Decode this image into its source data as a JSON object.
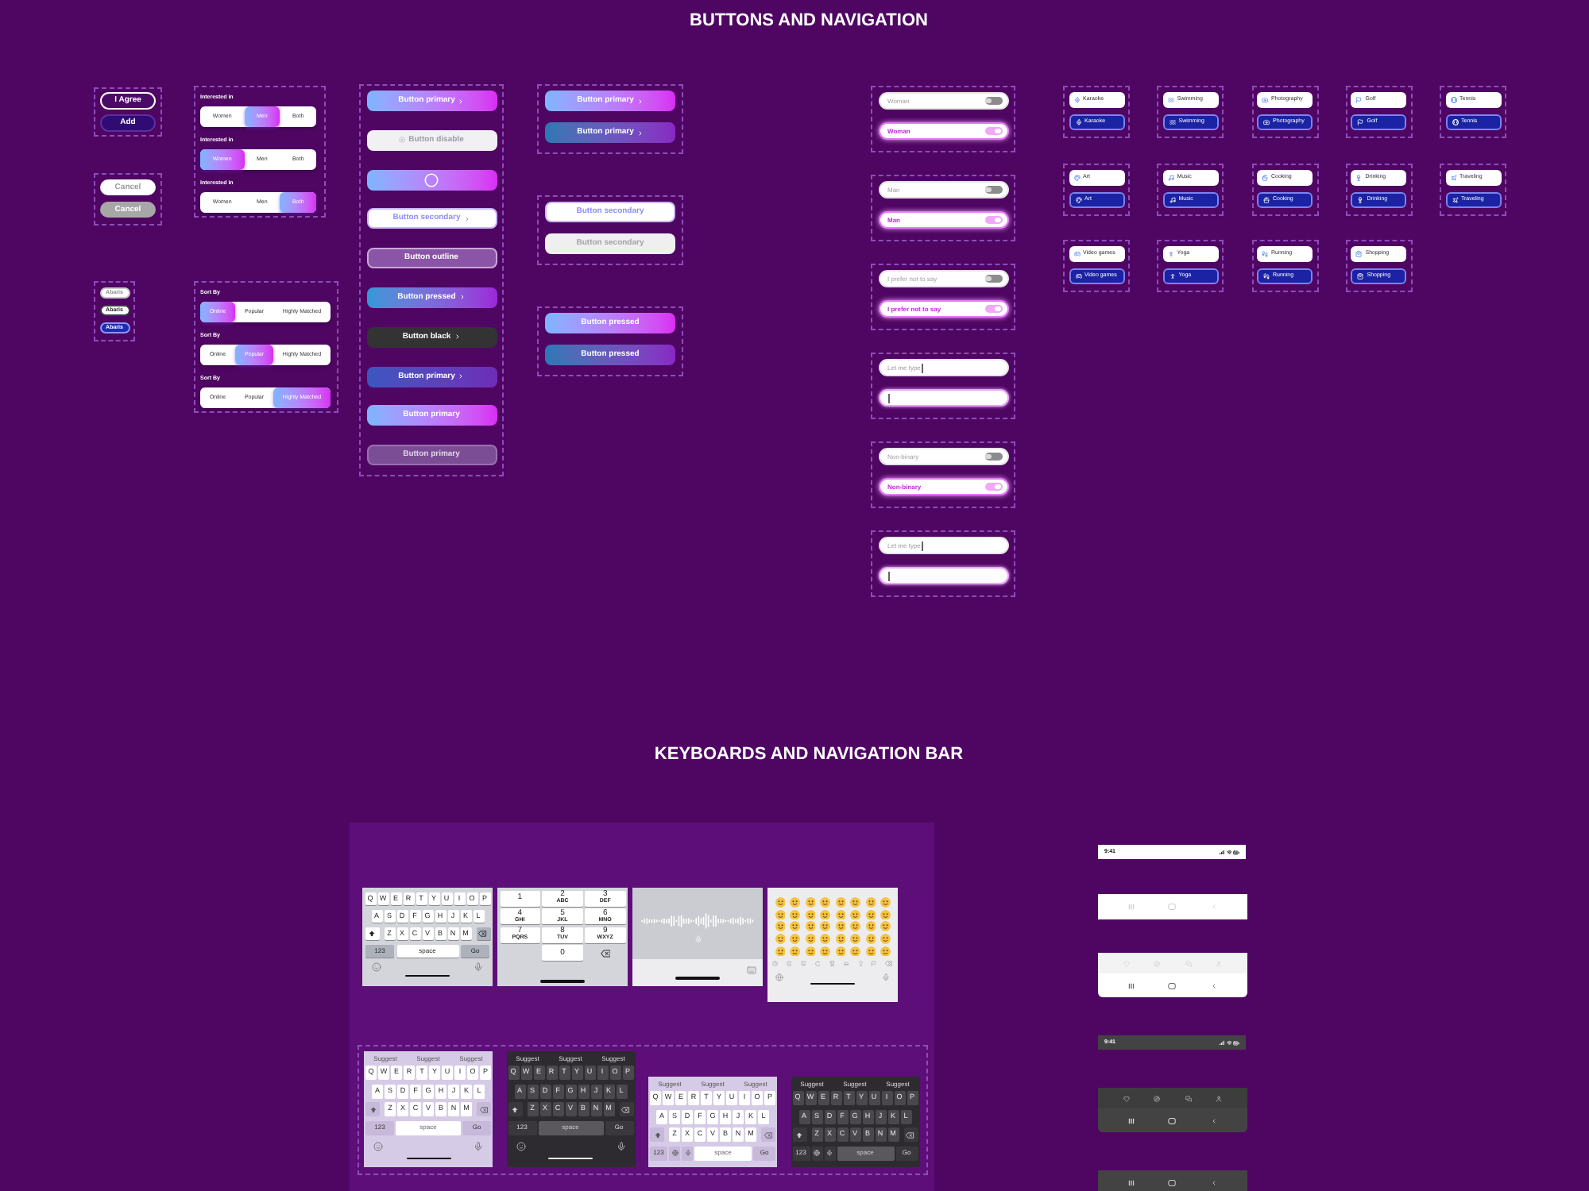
{
  "buttons_header": {
    "title": "BUTTONS AND NAVIGATION"
  },
  "pill_buttons": [
    {
      "label": "I Agree",
      "kind": "outline"
    },
    {
      "label": "Add",
      "kind": "filled"
    }
  ],
  "cancel_buttons": [
    {
      "label": "Cancel",
      "disabled": true
    },
    {
      "label": "Cancel",
      "disabled": false
    }
  ],
  "chips": [
    {
      "label": "Abaris",
      "disabled": true,
      "selected": false
    },
    {
      "label": "Abaris",
      "disabled": false,
      "selected": false
    },
    {
      "label": "Abaris",
      "disabled": false,
      "selected": true
    }
  ],
  "interest_selectors": [
    {
      "label": "Interested in",
      "options": [
        {
          "label": "Women",
          "selected": false
        },
        {
          "label": "Men",
          "selected": true
        },
        {
          "label": "Both",
          "selected": false
        }
      ]
    },
    {
      "label": "Interested in",
      "options": [
        {
          "label": "Women",
          "selected": true
        },
        {
          "label": "Men",
          "selected": false
        },
        {
          "label": "Both",
          "selected": false
        }
      ]
    },
    {
      "label": "Interested in",
      "options": [
        {
          "label": "Women",
          "selected": false
        },
        {
          "label": "Men",
          "selected": false
        },
        {
          "label": "Both",
          "selected": true
        }
      ]
    }
  ],
  "sort_selectors": [
    {
      "label": "Sort By",
      "options": [
        {
          "label": "Online",
          "selected": true
        },
        {
          "label": "Popular",
          "selected": false
        },
        {
          "label": "Highly Matched",
          "selected": false
        }
      ]
    },
    {
      "label": "Sort By",
      "options": [
        {
          "label": "Online",
          "selected": false
        },
        {
          "label": "Popular",
          "selected": true
        },
        {
          "label": "Highly Matched",
          "selected": false
        }
      ]
    },
    {
      "label": "Sort By",
      "options": [
        {
          "label": "Online",
          "selected": false
        },
        {
          "label": "Popular",
          "selected": false
        },
        {
          "label": "Highly Matched",
          "selected": true
        }
      ]
    }
  ],
  "button_stack": [
    {
      "label": "Button primary",
      "kind": "gradient",
      "chevron": true
    },
    {
      "label": "Button disable",
      "kind": "disabled",
      "chevron": false
    },
    {
      "kind": "loading",
      "chevron": false
    },
    {
      "label": "Button secondary",
      "kind": "secondary",
      "chevron": true
    },
    {
      "label": "Button outline",
      "kind": "outline",
      "chevron": false
    },
    {
      "label": "Button pressed",
      "kind": "pressed",
      "chevron": true
    },
    {
      "label": "Button black",
      "kind": "black",
      "chevron": true
    },
    {
      "label": "Button primary",
      "kind": "deep",
      "chevron": true
    },
    {
      "label": "Button primary",
      "kind": "gradient",
      "chevron": false
    },
    {
      "label": "Button primary",
      "kind": "faded",
      "chevron": false
    }
  ],
  "button_pairs": [
    {
      "buttons": [
        {
          "label": "Button primary",
          "kind": "gradient",
          "chevron": true
        },
        {
          "label": "Button primary",
          "kind": "dark_gradient",
          "chevron": true
        }
      ]
    },
    {
      "buttons": [
        {
          "label": "Button secondary",
          "kind": "secondary",
          "chevron": false
        },
        {
          "label": "Button secondary",
          "kind": "gray",
          "chevron": false
        }
      ]
    },
    {
      "buttons": [
        {
          "label": "Button pressed",
          "kind": "gradient",
          "chevron": false
        },
        {
          "label": "Button pressed",
          "kind": "dark_gradient",
          "chevron": false
        }
      ]
    }
  ],
  "field_groups": [
    {
      "fields": [
        {
          "kind": "choice",
          "label": "Woman",
          "selected": false
        },
        {
          "kind": "choice",
          "label": "Woman",
          "selected": true
        }
      ]
    },
    {
      "fields": [
        {
          "kind": "choice",
          "label": "Man",
          "selected": false
        },
        {
          "kind": "choice",
          "label": "Man",
          "selected": true
        }
      ]
    },
    {
      "fields": [
        {
          "kind": "choice",
          "label": "I prefer not to say",
          "selected": false
        },
        {
          "kind": "choice",
          "label": "I prefer not to say",
          "selected": true
        }
      ]
    },
    {
      "fields": [
        {
          "kind": "text",
          "placeholder": "Let me type",
          "focused": false
        },
        {
          "kind": "text",
          "focused": true
        }
      ]
    },
    {
      "fields": [
        {
          "kind": "choice",
          "label": "Non-binary",
          "selected": false
        },
        {
          "kind": "choice",
          "label": "Non-binary",
          "selected": true
        }
      ]
    },
    {
      "fields": [
        {
          "kind": "text",
          "placeholder": "Let me type",
          "focused": false
        },
        {
          "kind": "text",
          "focused": true
        }
      ]
    }
  ],
  "tag_groups": [
    {
      "tags": [
        {
          "label": "Karaoke",
          "selected": false
        },
        {
          "label": "Karaoke",
          "selected": true
        }
      ]
    },
    {
      "tags": [
        {
          "label": "Swimming",
          "selected": false
        },
        {
          "label": "Swimming",
          "selected": true
        }
      ]
    },
    {
      "tags": [
        {
          "label": "Photography",
          "selected": false
        },
        {
          "label": "Photography",
          "selected": true
        }
      ]
    },
    {
      "tags": [
        {
          "label": "Golf",
          "selected": false
        },
        {
          "label": "Golf",
          "selected": true
        }
      ]
    },
    {
      "tags": [
        {
          "label": "Tennis",
          "selected": false
        },
        {
          "label": "Tennis",
          "selected": true
        }
      ]
    },
    {
      "tags": [
        {
          "label": "Art",
          "selected": false
        },
        {
          "label": "Art",
          "selected": true
        }
      ]
    },
    {
      "tags": [
        {
          "label": "Music",
          "selected": false
        },
        {
          "label": "Music",
          "selected": true
        }
      ]
    },
    {
      "tags": [
        {
          "label": "Cooking",
          "selected": false
        },
        {
          "label": "Cooking",
          "selected": true
        }
      ]
    },
    {
      "tags": [
        {
          "label": "Drinking",
          "selected": false
        },
        {
          "label": "Drinking",
          "selected": true
        }
      ]
    },
    {
      "tags": [
        {
          "label": "Traveling",
          "selected": false
        },
        {
          "label": "Traveling",
          "selected": true
        }
      ]
    },
    {
      "tags": [
        {
          "label": "Video games",
          "selected": false
        },
        {
          "label": "Video games",
          "selected": true
        }
      ]
    },
    {
      "tags": [
        {
          "label": "Yoga",
          "selected": false
        },
        {
          "label": "Yoga",
          "selected": true
        }
      ]
    },
    {
      "tags": [
        {
          "label": "Running",
          "selected": false
        },
        {
          "label": "Running",
          "selected": true
        }
      ]
    },
    {
      "tags": [
        {
          "label": "Shopping",
          "selected": false
        },
        {
          "label": "Shopping",
          "selected": true
        }
      ]
    }
  ],
  "keyboards_header": {
    "title": "KEYBOARDS AND NAVIGATION BAR"
  },
  "ios_keyboards": [
    {
      "kind": "alphabetic",
      "rows": [
        [
          "Q",
          "W",
          "E",
          "R",
          "T",
          "Y",
          "U",
          "I",
          "O",
          "P"
        ],
        [
          "A",
          "S",
          "D",
          "F",
          "G",
          "H",
          "J",
          "K",
          "L"
        ],
        [
          "Z",
          "X",
          "C",
          "V",
          "B",
          "N",
          "M"
        ]
      ],
      "mode_key": "123",
      "space_key": "space",
      "return_key": "Go"
    },
    {
      "kind": "numeric",
      "keys": [
        {
          "digit": "1"
        },
        {
          "digit": "2",
          "letters": "ABC"
        },
        {
          "digit": "3",
          "letters": "DEF"
        },
        {
          "digit": "4",
          "letters": "GHI"
        },
        {
          "digit": "5",
          "letters": "JKL"
        },
        {
          "digit": "6",
          "letters": "MNO"
        },
        {
          "digit": "7",
          "letters": "PQRS"
        },
        {
          "digit": "8",
          "letters": "TUV"
        },
        {
          "digit": "9",
          "letters": "WXYZ"
        },
        {
          "digit": "0"
        }
      ]
    },
    {
      "kind": "dictation"
    },
    {
      "kind": "emoji"
    }
  ],
  "android_keyboards": [
    {
      "kind": "full",
      "dark": false,
      "suggestions": [
        "Suggest",
        "Suggest",
        "Suggest"
      ],
      "rows": [
        [
          "Q",
          "W",
          "E",
          "R",
          "T",
          "Y",
          "U",
          "I",
          "O",
          "P"
        ],
        [
          "A",
          "S",
          "D",
          "F",
          "G",
          "H",
          "J",
          "K",
          "L"
        ],
        [
          "Z",
          "X",
          "C",
          "V",
          "B",
          "N",
          "M"
        ]
      ],
      "mode_key": "123",
      "space_key": "space",
      "return_key": "Go"
    },
    {
      "kind": "full",
      "dark": true,
      "suggestions": [
        "Suggest",
        "Suggest",
        "Suggest"
      ],
      "rows": [
        [
          "Q",
          "W",
          "E",
          "R",
          "T",
          "Y",
          "U",
          "I",
          "O",
          "P"
        ],
        [
          "A",
          "S",
          "D",
          "F",
          "G",
          "H",
          "J",
          "K",
          "L"
        ],
        [
          "Z",
          "X",
          "C",
          "V",
          "B",
          "N",
          "M"
        ]
      ],
      "mode_key": "123",
      "space_key": "space",
      "return_key": "Go"
    },
    {
      "kind": "compact",
      "dark": false,
      "suggestions": [
        "Suggest",
        "Suggest",
        "Suggest"
      ],
      "rows": [
        [
          "Q",
          "W",
          "E",
          "R",
          "T",
          "Y",
          "U",
          "I",
          "O",
          "P"
        ],
        [
          "A",
          "S",
          "D",
          "F",
          "G",
          "H",
          "J",
          "K",
          "L"
        ],
        [
          "Z",
          "X",
          "C",
          "V",
          "B",
          "N",
          "M"
        ]
      ],
      "mode_key": "123",
      "space_key": "space",
      "return_key": "Go"
    },
    {
      "kind": "compact",
      "dark": true,
      "suggestions": [
        "Suggest",
        "Suggest",
        "Suggest"
      ],
      "rows": [
        [
          "Q",
          "W",
          "E",
          "R",
          "T",
          "Y",
          "U",
          "I",
          "O",
          "P"
        ],
        [
          "A",
          "S",
          "D",
          "F",
          "G",
          "H",
          "J",
          "K",
          "L"
        ],
        [
          "Z",
          "X",
          "C",
          "V",
          "B",
          "N",
          "M"
        ]
      ],
      "mode_key": "123",
      "space_key": "space",
      "return_key": "Go"
    }
  ],
  "nav_bars": [
    {
      "kind": "status",
      "dark": false,
      "time": "9:41"
    },
    {
      "kind": "buttons",
      "dark": false
    },
    {
      "kind": "tabs",
      "dark": false
    },
    {
      "kind": "status",
      "dark": true,
      "time": "9:41"
    },
    {
      "kind": "tabs",
      "dark": true
    },
    {
      "kind": "buttons",
      "dark": true
    }
  ]
}
